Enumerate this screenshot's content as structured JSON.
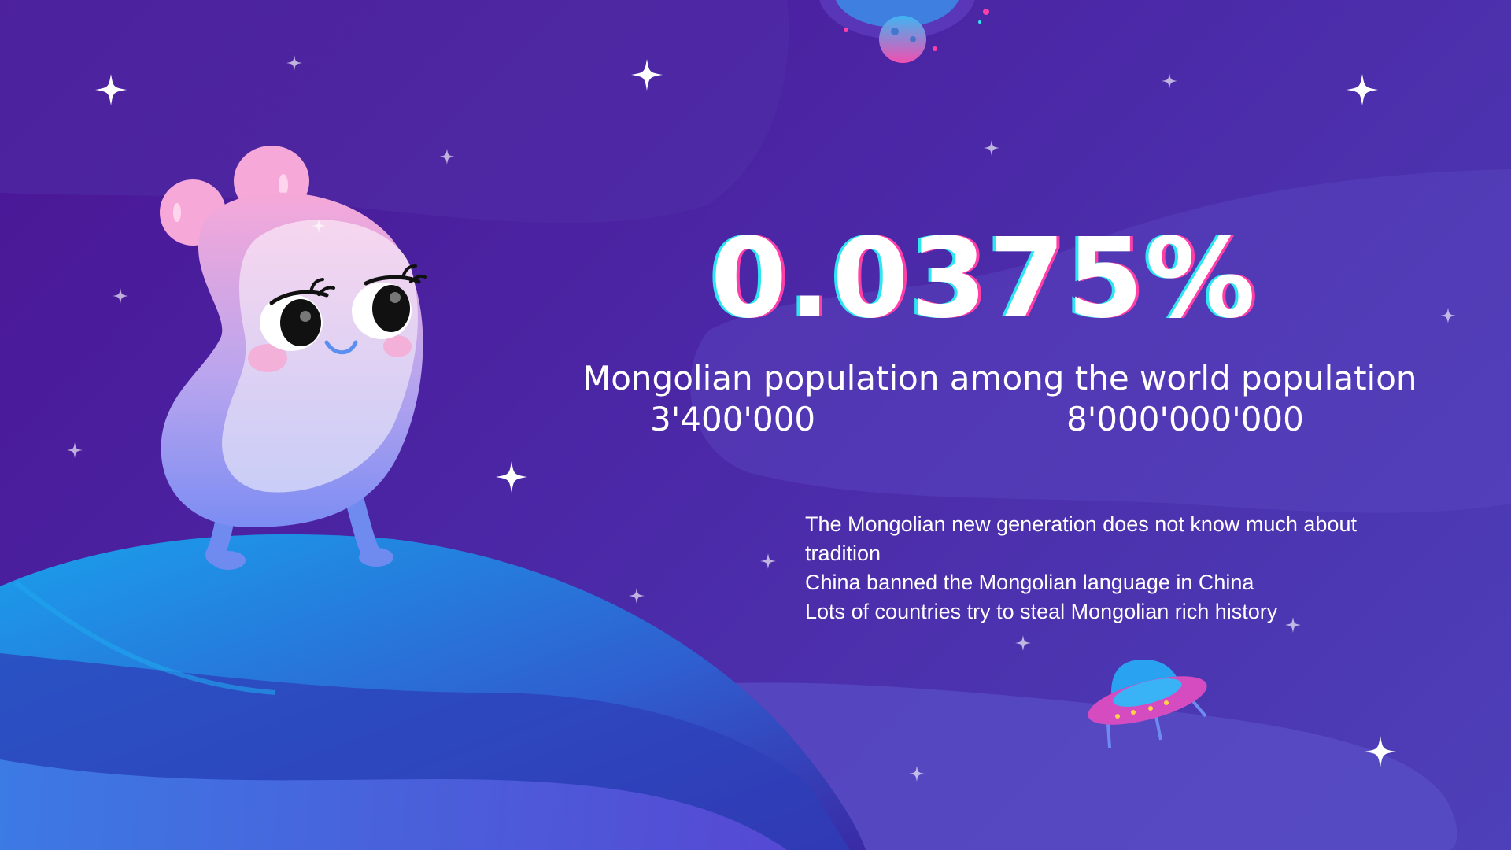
{
  "stat": {
    "value": "0.0375%"
  },
  "subtitle": "Mongolian population among the world population",
  "populations": {
    "mongolia": "3'400'000",
    "world": "8'000'000'000"
  },
  "facts": [
    " The Mongolian new generation does not know much about tradition",
    "China banned the Mongolian language in China",
    "Lots of countries try to steal Mongolian rich history"
  ],
  "colors": {
    "background": "#4b27a6",
    "stat_shadow_cyan": "#2ee6f2",
    "stat_shadow_pink": "#ff3fa8",
    "character_pink": "#f4a6d8",
    "character_blue": "#7b8cf2",
    "planet_blue": "#1e8fe6"
  },
  "icons": [
    "sparkle-star-icon",
    "ufo-icon",
    "moon-planet-icon",
    "cute-alien-character"
  ]
}
